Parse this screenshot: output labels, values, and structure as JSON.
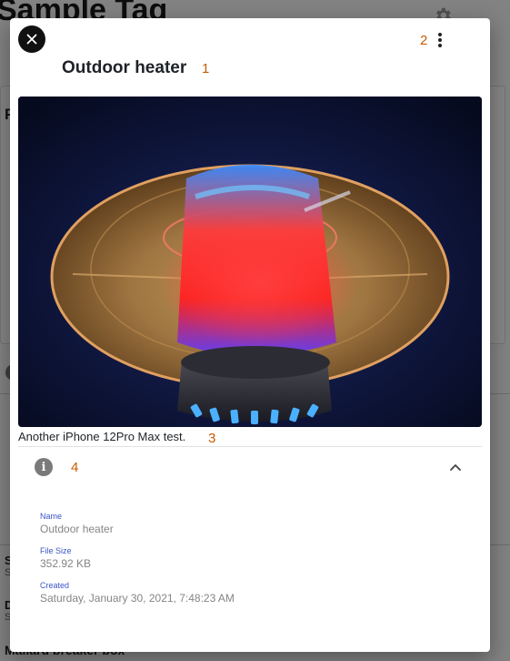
{
  "background": {
    "page_title": "Sample Tag",
    "card_letter": "F",
    "rows": [
      {
        "initial": "S",
        "sub": "S"
      },
      {
        "initial": "D",
        "sub": "S"
      }
    ],
    "bottom_item": "Mallard breaker box"
  },
  "modal": {
    "title": "Outdoor heater",
    "caption": "Another iPhone 12Pro Max test.",
    "annotations": {
      "title": "1",
      "menu": "2",
      "caption": "3",
      "info": "4"
    },
    "details": [
      {
        "label": "Name",
        "value": "Outdoor heater"
      },
      {
        "label": "File Size",
        "value": "352.92 KB"
      },
      {
        "label": "Created",
        "value": "Saturday, January 30, 2021, 7:48:23 AM"
      }
    ]
  },
  "icons": {
    "close": "close-icon",
    "menu": "more-vertical-icon",
    "info": "info-icon",
    "expand": "chevron-up-icon",
    "settings": "gear-icon"
  },
  "colors": {
    "annotation": "#c65d00",
    "detail_label": "#3a55c8",
    "detail_value": "#858585"
  }
}
